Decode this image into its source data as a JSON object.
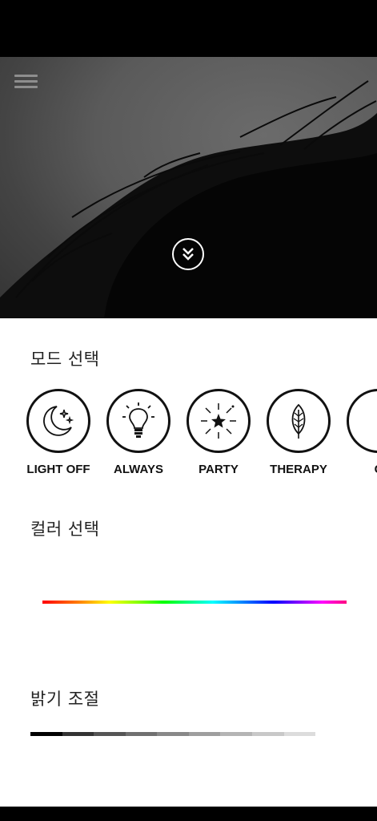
{
  "modes_title": "모드 선택",
  "color_title": "컬러 선택",
  "brightness_title": "밝기 조절",
  "modes": [
    {
      "label": "LIGHT OFF",
      "icon": "moon-stars-icon"
    },
    {
      "label": "ALWAYS",
      "icon": "lightbulb-icon"
    },
    {
      "label": "PARTY",
      "icon": "sparkle-star-icon"
    },
    {
      "label": "THERAPY",
      "icon": "leaf-icon"
    },
    {
      "label": "C",
      "icon": "partial-mode-icon"
    }
  ],
  "brightness_colors": [
    "#000000",
    "#333333",
    "#555555",
    "#707070",
    "#888888",
    "#9e9e9e",
    "#b4b4b4",
    "#c8c8c8",
    "#dcdcdc"
  ]
}
